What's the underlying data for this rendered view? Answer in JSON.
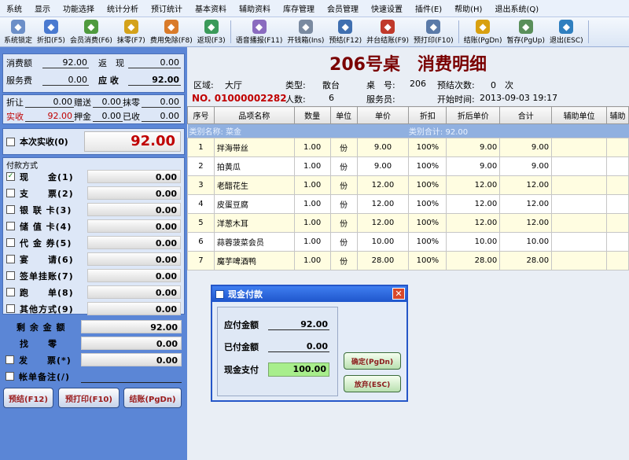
{
  "menu": [
    "系统",
    "显示",
    "功能选择",
    "统计分析",
    "预订统计",
    "基本资料",
    "辅助资料",
    "库存管理",
    "会员管理",
    "快速设置",
    "插件(E)",
    "帮助(H)",
    "退出系统(Q)"
  ],
  "toolbar": [
    {
      "label": "系统锁定",
      "icon": "lock-icon",
      "color": "#6c8fc8"
    },
    {
      "label": "折扣(F5)",
      "icon": "discount-icon",
      "color": "#4a7ad0"
    },
    {
      "label": "会员消费(F6)",
      "icon": "members-icon",
      "color": "#4f9a3e"
    },
    {
      "label": "抹零(F7)",
      "icon": "coins-icon",
      "color": "#d4a21a"
    },
    {
      "label": "费用免除(F8)",
      "icon": "waive-icon",
      "color": "#d97b2a"
    },
    {
      "label": "返现(F3)",
      "icon": "cashback-icon",
      "color": "#3b9a5a"
    },
    {
      "label": "语音播报(F11)",
      "icon": "speaker-icon",
      "color": "#8a6bbf"
    },
    {
      "label": "开钱箱(Ins)",
      "icon": "cashbox-icon",
      "color": "#7a8aa0"
    },
    {
      "label": "预结(F12)",
      "icon": "prebill-icon",
      "color": "#3f6fb0"
    },
    {
      "label": "并台结账(F9)",
      "icon": "merge-icon",
      "color": "#c0392b"
    },
    {
      "label": "预打印(F10)",
      "icon": "printer-icon",
      "color": "#5a7aa8"
    },
    {
      "label": "结账(PgDn)",
      "icon": "checkout-icon",
      "color": "#d8a010"
    },
    {
      "label": "暂存(PgUp)",
      "icon": "save-icon",
      "color": "#5a8f5a"
    },
    {
      "label": "退出(ESC)",
      "icon": "exit-icon",
      "color": "#2f7fbf"
    }
  ],
  "summary": {
    "consume_label": "消费额",
    "consume_value": "92.00",
    "return_label": "返　现",
    "return_value": "0.00",
    "service_label": "服务费",
    "service_value": "0.00",
    "receivable_label": "应 收",
    "receivable_value": "92.00",
    "discount_label": "折让",
    "discount_value": "0.00",
    "gift_label": "赠送",
    "gift_value": "0.00",
    "round_label": "抹零",
    "round_value": "0.00",
    "actual_label": "实收",
    "actual_value": "92.00",
    "deposit_label": "押金",
    "deposit_value": "0.00",
    "received_label": "已收",
    "received_value": "0.00"
  },
  "this_received": {
    "label": "本次实收(0)",
    "value": "92.00"
  },
  "payment_title": "付款方式",
  "payments": [
    {
      "label": "现　　金(1)",
      "value": "0.00",
      "checked": true
    },
    {
      "label": "支　　票(2)",
      "value": "0.00",
      "checked": false
    },
    {
      "label": "银 联 卡(3)",
      "value": "0.00",
      "checked": false
    },
    {
      "label": "储 值 卡(4)",
      "value": "0.00",
      "checked": false
    },
    {
      "label": "代 金 券(5)",
      "value": "0.00",
      "checked": false
    },
    {
      "label": "宴　　请(6)",
      "value": "0.00",
      "checked": false
    },
    {
      "label": "签单挂账(7)",
      "value": "0.00",
      "checked": false
    },
    {
      "label": "跑　　单(8)",
      "value": "0.00",
      "checked": false
    },
    {
      "label": "其他方式(9)",
      "value": "0.00",
      "checked": false
    }
  ],
  "remaining": {
    "label": "剩 余 金 额",
    "value": "92.00"
  },
  "change": {
    "label": "找　　零",
    "value": "0.00"
  },
  "invoice": {
    "label": "发　　票(*)",
    "value": "0.00"
  },
  "note": {
    "label": "帐单备注(/)"
  },
  "buttons": {
    "prebill": "预结(F12)",
    "preprint": "预打印(F10)",
    "checkout": "结账(PgDn)"
  },
  "header": {
    "title": "206号桌　消费明细"
  },
  "info": {
    "area_label": "区域:",
    "area_value": "大厅",
    "type_label": "类型:",
    "type_value": "散台",
    "table_label": "桌　号:",
    "table_value": "206",
    "prebill_count_label": "预结次数:",
    "prebill_count_value": "0　次",
    "order_no": "NO. 01000002282",
    "people_label": "人数:",
    "people_value": "6",
    "waiter_label": "服务员:",
    "start_label": "开始时间:",
    "start_value": "2013-09-03 19:17"
  },
  "table": {
    "columns": [
      "序号",
      "品项名称",
      "数量",
      "单位",
      "单价",
      "折扣",
      "折后单价",
      "合计",
      "辅助单位",
      "辅助"
    ],
    "category": {
      "name": "类别名称: 菜金",
      "subtotal": "类别合计: 92.00"
    },
    "rows": [
      [
        "1",
        "拌海带丝",
        "1.00",
        "份",
        "9.00",
        "100%",
        "9.00",
        "9.00",
        "",
        ""
      ],
      [
        "2",
        "拍黄瓜",
        "1.00",
        "份",
        "9.00",
        "100%",
        "9.00",
        "9.00",
        "",
        ""
      ],
      [
        "3",
        "老醋花生",
        "1.00",
        "份",
        "12.00",
        "100%",
        "12.00",
        "12.00",
        "",
        ""
      ],
      [
        "4",
        "皮蛋豆腐",
        "1.00",
        "份",
        "12.00",
        "100%",
        "12.00",
        "12.00",
        "",
        ""
      ],
      [
        "5",
        "洋葱木耳",
        "1.00",
        "份",
        "12.00",
        "100%",
        "12.00",
        "12.00",
        "",
        ""
      ],
      [
        "6",
        "蒜蓉菠菜会员",
        "1.00",
        "份",
        "10.00",
        "100%",
        "10.00",
        "10.00",
        "",
        ""
      ],
      [
        "7",
        "魔芋啤酒鸭",
        "1.00",
        "份",
        "28.00",
        "100%",
        "28.00",
        "28.00",
        "",
        ""
      ]
    ]
  },
  "dialog": {
    "title": "现金付款",
    "due_label": "应付金额",
    "due_value": "92.00",
    "paid_label": "已付金额",
    "paid_value": "0.00",
    "cash_label": "现金支付",
    "cash_value": "100.00",
    "ok": "确定(PgDn)",
    "cancel": "放弃(ESC)"
  }
}
